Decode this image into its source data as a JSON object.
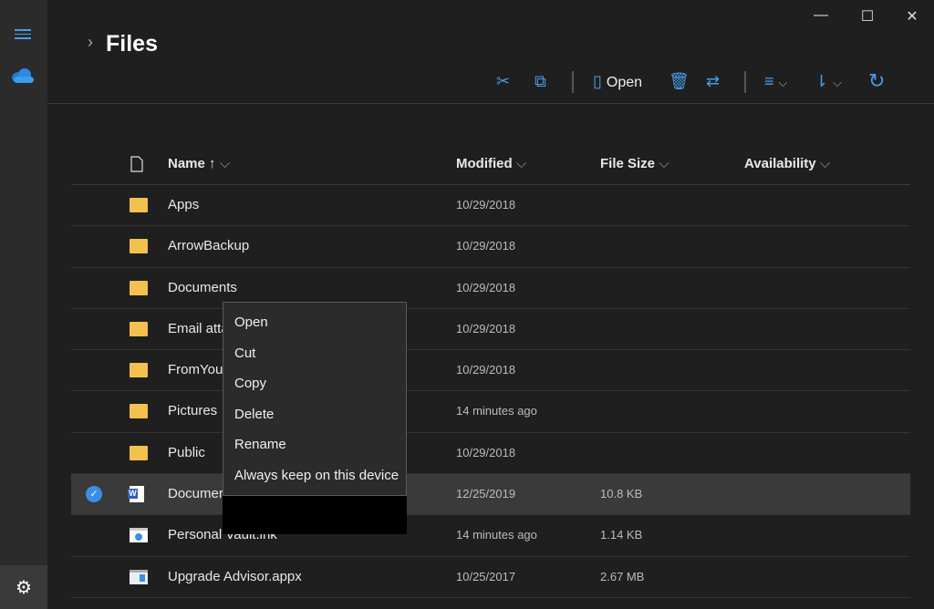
{
  "window": {
    "minimize": "—",
    "maximize": "☐",
    "close": "✕"
  },
  "header": {
    "title": "Files",
    "chevron": "›"
  },
  "toolbar": {
    "open_label": "Open",
    "cut": "✂",
    "copy": "⧉",
    "delete": "🗑",
    "rename": "⇄",
    "view": "≡",
    "sort": "⇂",
    "chevron": "⌵",
    "refresh": "↻"
  },
  "columns": {
    "name": "Name ↑",
    "modified": "Modified",
    "size": "File Size",
    "availability": "Availability",
    "chevron": "⌵"
  },
  "rows": [
    {
      "name": "Apps",
      "modified": "10/29/2018",
      "size": "",
      "type": "folder"
    },
    {
      "name": "ArrowBackup",
      "modified": "10/29/2018",
      "size": "",
      "type": "folder"
    },
    {
      "name": "Documents",
      "modified": "10/29/2018",
      "size": "",
      "type": "folder"
    },
    {
      "name": "Email atta",
      "modified": "10/29/2018",
      "size": "",
      "type": "folder"
    },
    {
      "name": "FromYour",
      "modified": "10/29/2018",
      "size": "",
      "type": "folder"
    },
    {
      "name": "Pictures",
      "modified": "14 minutes ago",
      "size": "",
      "type": "folder"
    },
    {
      "name": "Public",
      "modified": "10/29/2018",
      "size": "",
      "type": "folder"
    },
    {
      "name": "Documer",
      "modified": "12/25/2019",
      "size": "10.8 KB",
      "type": "word",
      "selected": true
    },
    {
      "name": "Personal Vault.lnk",
      "modified": "14 minutes ago",
      "size": "1.14 KB",
      "type": "link"
    },
    {
      "name": "Upgrade Advisor.appx",
      "modified": "10/25/2017",
      "size": "2.67 MB",
      "type": "app"
    }
  ],
  "context_menu": [
    "Open",
    "Cut",
    "Copy",
    "Delete",
    "Rename",
    "Always keep on this device"
  ],
  "colors": {
    "accent": "#4a9be8",
    "folder": "#f2c14e",
    "background": "#1f1f1f"
  }
}
